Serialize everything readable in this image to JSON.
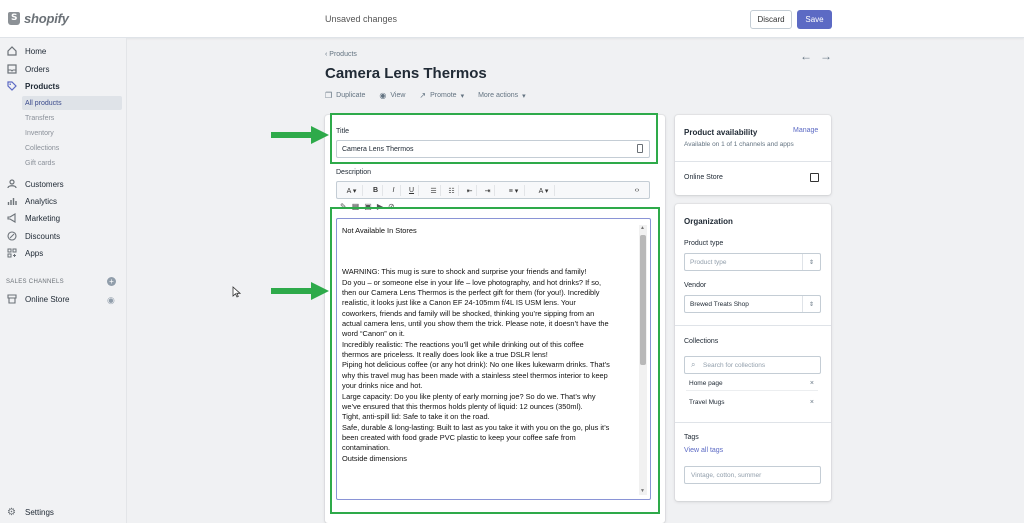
{
  "topbar": {
    "logo_text": "shopify",
    "status": "Unsaved changes",
    "discard_label": "Discard",
    "save_label": "Save"
  },
  "sidebar": {
    "items": [
      {
        "label": "Home",
        "icon": "home-icon"
      },
      {
        "label": "Orders",
        "icon": "orders-icon"
      },
      {
        "label": "Products",
        "icon": "tag-icon"
      },
      {
        "label": "Customers",
        "icon": "person-icon"
      },
      {
        "label": "Analytics",
        "icon": "bar-chart-icon"
      },
      {
        "label": "Marketing",
        "icon": "megaphone-icon"
      },
      {
        "label": "Discounts",
        "icon": "discount-icon"
      },
      {
        "label": "Apps",
        "icon": "apps-icon"
      }
    ],
    "product_subitems": [
      "All products",
      "Transfers",
      "Inventory",
      "Collections",
      "Gift cards"
    ],
    "channels_heading": "SALES CHANNELS",
    "online_store": "Online Store",
    "settings": "Settings"
  },
  "page": {
    "back_label": "Products",
    "title": "Camera Lens Thermos",
    "actions": [
      "Duplicate",
      "View",
      "Promote",
      "More actions"
    ]
  },
  "form": {
    "title_label": "Title",
    "title_value": "Camera Lens Thermos",
    "description_label": "Description",
    "description_lines": [
      "Not Available In Stores",
      "",
      "",
      "",
      "WARNING: This mug is sure to shock and surprise your friends and family!",
      "Do you – or someone else in your life – love photography, and hot drinks? If so,",
      "then our Camera Lens Thermos is the perfect gift for them (for you!). Incredibly",
      "realistic, it looks just like a Canon EF 24-105mm f/4L IS USM lens. Your",
      "coworkers, friends and family will be shocked, thinking you’re sipping from an",
      "actual camera lens, until you show them the trick. Please note, it doesn’t have the",
      "word “Canon” on it.",
      "Incredibly realistic: The reactions you’ll get while drinking out of this coffee",
      "thermos are priceless. It really does look like a true DSLR lens!",
      "Piping hot delicious coffee (or any hot drink): No one likes lukewarm drinks. That’s",
      "why this travel mug has been made with a stainless steel thermos interior to keep",
      "your drinks nice and hot.",
      "Large capacity: Do you like plenty of early morning joe? So do we. That’s why",
      "we’ve ensured that this thermos holds plenty of liquid: 12 ounces (350ml).",
      "Tight, anti-spill lid: Safe to take it on the road.",
      "Safe, durable & long-lasting: Built to last as you take it with you on the go, plus it’s",
      "been created with food grade PVC plastic to keep your coffee safe from",
      "contamination.",
      "Outside dimensions"
    ]
  },
  "availability": {
    "title": "Product availability",
    "manage_label": "Manage",
    "subtitle": "Available on 1 of 1 channels and apps",
    "channel": "Online Store"
  },
  "organization": {
    "title": "Organization",
    "product_type_label": "Product type",
    "product_type_placeholder": "Product type",
    "vendor_label": "Vendor",
    "vendor_value": "Brewed Treats Shop",
    "collections_label": "Collections",
    "collections_placeholder": "Search for collections",
    "collections": [
      "Home page",
      "Travel Mugs"
    ],
    "tags_label": "Tags",
    "view_all_tags": "View all tags",
    "tags_placeholder": "Vintage, cotton, summer"
  },
  "colors": {
    "accent": "#5c6ac4",
    "highlight": "#2eaa4a"
  }
}
